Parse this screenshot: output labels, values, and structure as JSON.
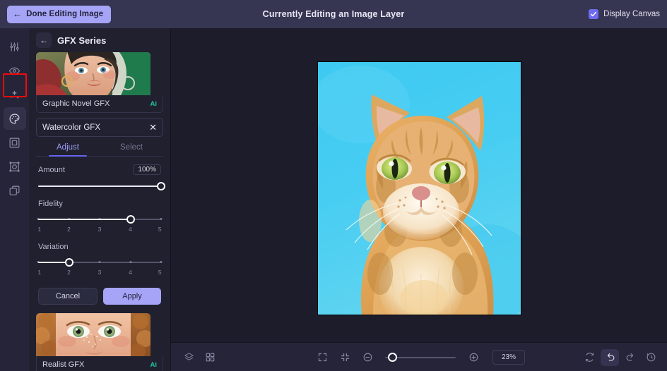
{
  "topbar": {
    "done_label": "Done Editing Image",
    "back_arrow_icon": "arrow-left-icon",
    "title": "Currently Editing an Image Layer",
    "display_canvas_label": "Display Canvas",
    "display_canvas_checked": true,
    "accent": "#a5a4f7",
    "bg": "#363552"
  },
  "rail": {
    "items": [
      {
        "name": "adjustments-icon",
        "selected": false
      },
      {
        "name": "eye-icon",
        "selected": false
      },
      {
        "name": "sparkles-icon",
        "selected": false
      },
      {
        "name": "palette-icon",
        "selected": true
      },
      {
        "name": "frame-icon",
        "selected": false
      },
      {
        "name": "transform-icon",
        "selected": false
      },
      {
        "name": "layers-copy-icon",
        "selected": false
      }
    ],
    "highlight_color": "#f50a0a"
  },
  "panel": {
    "back_icon": "arrow-left-icon",
    "title": "GFX Series",
    "cards": [
      {
        "name": "Graphic Novel GFX",
        "badge": "Ai"
      },
      {
        "name": "Realist GFX",
        "badge": "Ai"
      }
    ],
    "active_effect": {
      "title": "Watercolor GFX",
      "close_icon": "close-icon",
      "tabs": [
        {
          "label": "Adjust",
          "active": true
        },
        {
          "label": "Select",
          "active": false
        }
      ],
      "controls": [
        {
          "label": "Amount",
          "value_text": "100%",
          "kind": "percent",
          "percent": 100
        },
        {
          "label": "Fidelity",
          "kind": "steps",
          "value": 4,
          "ticks": [
            "1",
            "2",
            "3",
            "4",
            "5"
          ]
        },
        {
          "label": "Variation",
          "kind": "steps",
          "value": 2,
          "ticks": [
            "1",
            "2",
            "3",
            "4",
            "5"
          ]
        }
      ],
      "cancel_label": "Cancel",
      "apply_label": "Apply"
    },
    "badge_color": "#1ec8a0"
  },
  "canvas": {
    "artwork": "watercolor-orange-tabby-cat",
    "background_color": "#3bc9f0"
  },
  "bottombar": {
    "left_tools": [
      {
        "name": "layers-icon"
      },
      {
        "name": "grid-icon"
      }
    ],
    "center_tools": [
      {
        "name": "fit-screen-icon"
      },
      {
        "name": "shrink-icon"
      }
    ],
    "zoom_out_icon": "zoom-out-icon",
    "zoom_in_icon": "zoom-in-icon",
    "zoom_value": "23%",
    "zoom_slider_percent": 4,
    "right_tools": [
      {
        "name": "reset-icon",
        "active": false
      },
      {
        "name": "undo-icon",
        "active": true
      },
      {
        "name": "redo-icon",
        "active": false
      },
      {
        "name": "history-icon",
        "active": false
      }
    ]
  }
}
